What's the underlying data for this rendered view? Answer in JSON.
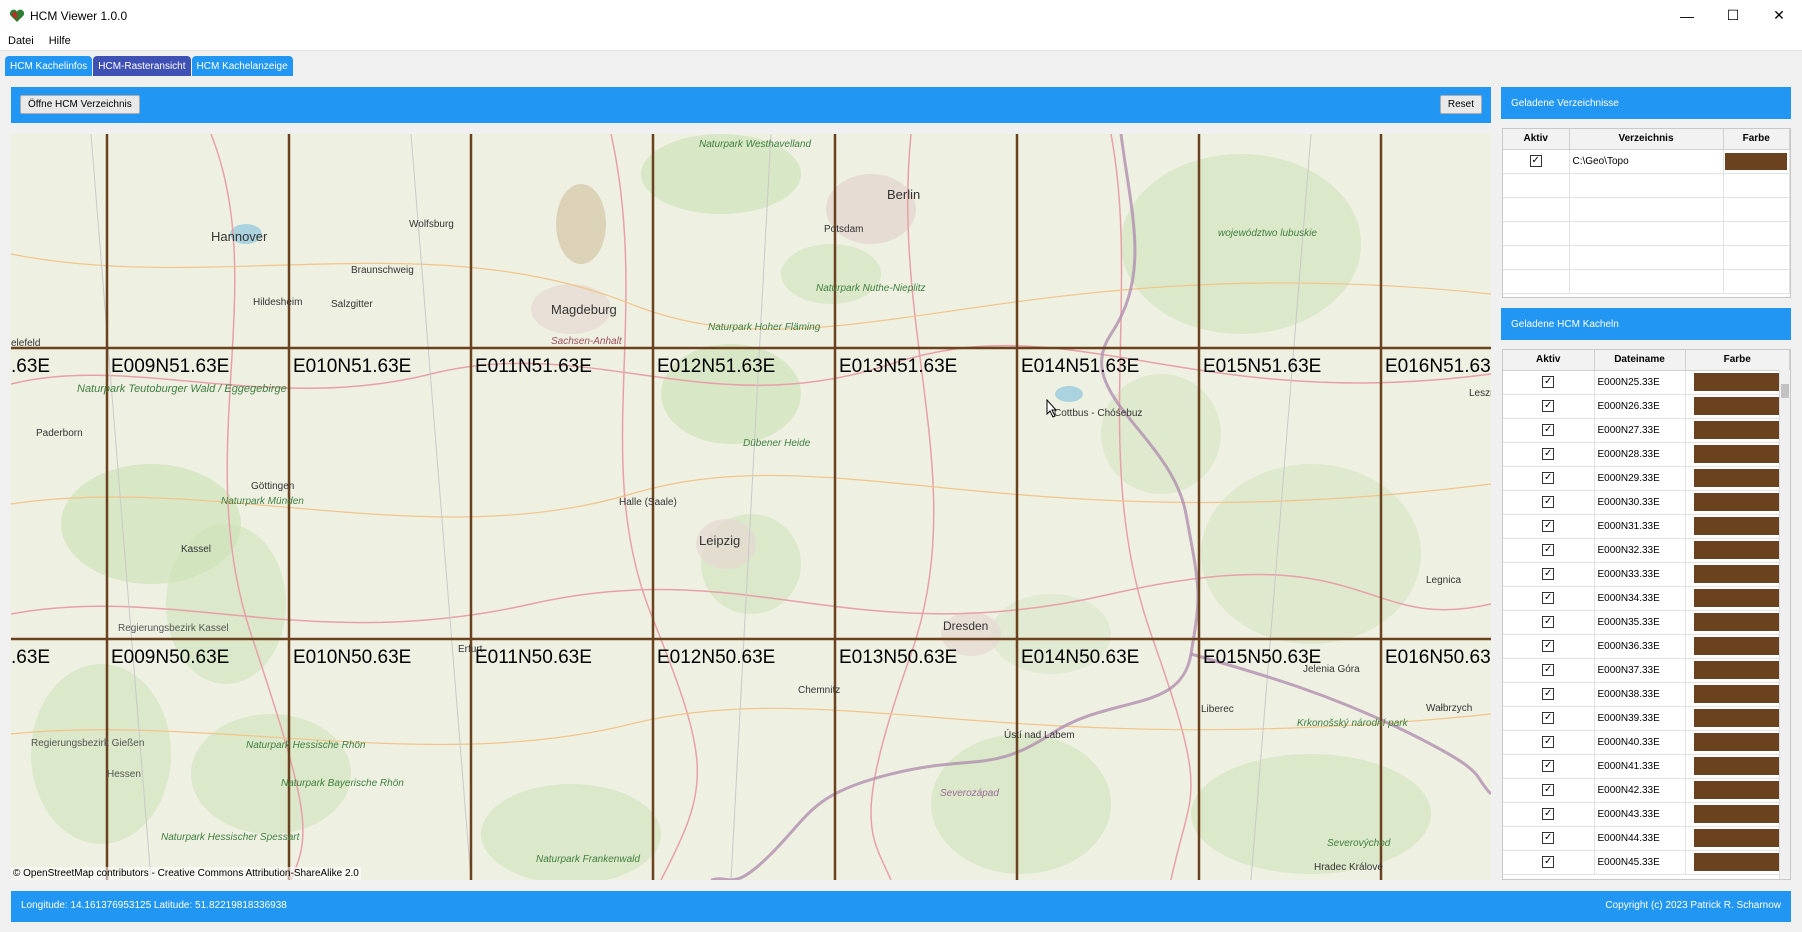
{
  "window": {
    "title": "HCM Viewer 1.0.0",
    "minimize": "—",
    "maximize": "☐",
    "close": "✕"
  },
  "menu": {
    "items": [
      "Datei",
      "Hilfe"
    ]
  },
  "tabs": [
    {
      "label": "HCM Kachelinfos",
      "active": false
    },
    {
      "label": "HCM-Rasteransicht",
      "active": true
    },
    {
      "label": "HCM Kachelanzeige",
      "active": false
    }
  ],
  "toolbar": {
    "open_label": "Öffne HCM Verzeichnis",
    "reset_label": "Reset"
  },
  "map": {
    "attribution": "© OpenStreetMap contributors - Creative Commons Attribution-ShareAlike 2.0",
    "tile_labels_row1": [
      ".63E",
      "E009N51.63E",
      "E010N51.63E",
      "E011N51.63E",
      "E012N51.63E",
      "E013N51.63E",
      "E014N51.63E",
      "E015N51.63E",
      "E016N51.63"
    ],
    "tile_labels_row2": [
      ".63E",
      "E009N50.63E",
      "E010N50.63E",
      "E011N50.63E",
      "E012N50.63E",
      "E013N50.63E",
      "E014N50.63E",
      "E015N50.63E",
      "E016N50.63"
    ],
    "places": [
      "Hannover",
      "Wolfsburg",
      "Berlin",
      "Potsdam",
      "Magdeburg",
      "Braunschweig",
      "Salzgitter",
      "Hildesheim",
      "Paderborn",
      "Göttingen",
      "Kassel",
      "Halle (Saale)",
      "Leipzig",
      "Dresden",
      "Chemnitz",
      "Cottbus - Chóśebuz",
      "Erfurt",
      "Liberec",
      "Jelenia Góra",
      "Wałbrzych",
      "Legnica",
      "Ústí nad Labem",
      "Hradec Králové",
      "Naturpark Westhavelland",
      "Naturpark Hoher Fläming",
      "Naturpark Nuthe-Nieplitz",
      "Dübener Heide",
      "województwo lubuskie",
      "Naturpark Teutoburger Wald / Eggegebirge",
      "Naturpark Münden",
      "Regierungsbezirk Kassel",
      "Regierungsbezirk Gießen",
      "Hessen",
      "Naturpark Hessische Rhön",
      "Naturpark Frankenwald",
      "Severozápad",
      "Krkonošský národní park",
      "Naturpark Hessischer Spessart",
      "Naturpark Bayerische Rhön",
      "Sachsen-Anhalt",
      "Leszno",
      "Severovýchod",
      "elefeld"
    ]
  },
  "panel1": {
    "title": "Geladene Verzeichnisse",
    "headers": [
      "Aktiv",
      "Verzeichnis",
      "Farbe"
    ],
    "rows": [
      {
        "active": "✓",
        "dir": "C:\\Geo\\Topo",
        "color": "#6b4220"
      }
    ]
  },
  "panel2": {
    "title": "Geladene HCM Kacheln",
    "headers": [
      "Aktiv",
      "Dateiname",
      "Farbe"
    ],
    "rows": [
      "E000N25.33E",
      "E000N26.33E",
      "E000N27.33E",
      "E000N28.33E",
      "E000N29.33E",
      "E000N30.33E",
      "E000N31.33E",
      "E000N32.33E",
      "E000N33.33E",
      "E000N34.33E",
      "E000N35.33E",
      "E000N36.33E",
      "E000N37.33E",
      "E000N38.33E",
      "E000N39.33E",
      "E000N40.33E",
      "E000N41.33E",
      "E000N42.33E",
      "E000N43.33E",
      "E000N44.33E",
      "E000N45.33E"
    ],
    "check": "✓",
    "color": "#6b4220"
  },
  "status": {
    "coords": "Longitude: 14.161376953125 Latitude: 51.82219818336938",
    "copyright": "Copyright (c) 2023 Patrick R. Scharnow"
  },
  "colors": {
    "accent": "#2196f3",
    "active_tab": "#3f51b5",
    "grid_line": "#6b4220"
  }
}
